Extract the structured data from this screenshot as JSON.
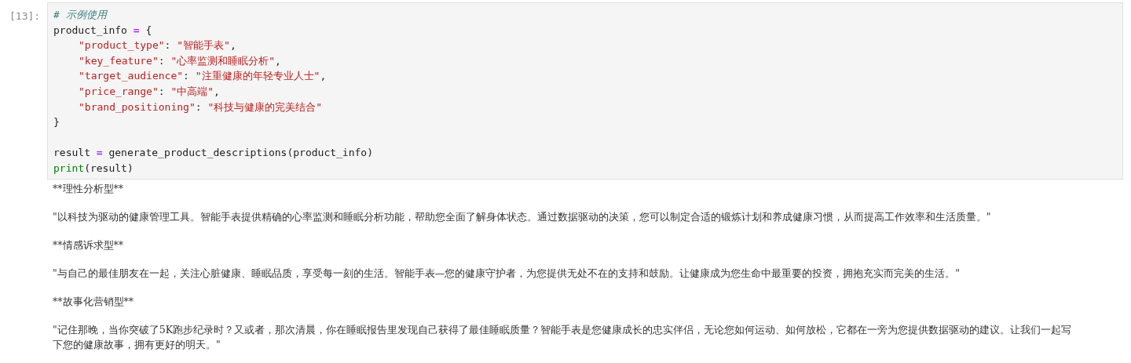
{
  "cell": {
    "prompt": "[13]:",
    "code_lines": [
      {
        "kind": "top",
        "tokens": [
          {
            "kind": "comment",
            "text": "# 示例使用"
          }
        ]
      },
      {
        "kind": "top",
        "tokens": [
          {
            "kind": "plain",
            "text": "product_info "
          },
          {
            "kind": "op",
            "text": "="
          },
          {
            "kind": "plain",
            "text": " {"
          }
        ]
      },
      {
        "kind": "entry",
        "tokens": [
          {
            "kind": "string",
            "text": "\"product_type\""
          },
          {
            "kind": "plain",
            "text": ": "
          },
          {
            "kind": "string",
            "text": "\"智能手表\""
          },
          {
            "kind": "plain",
            "text": ","
          }
        ]
      },
      {
        "kind": "entry",
        "tokens": [
          {
            "kind": "string",
            "text": "\"key_feature\""
          },
          {
            "kind": "plain",
            "text": ": "
          },
          {
            "kind": "string",
            "text": "\"心率监测和睡眠分析\""
          },
          {
            "kind": "plain",
            "text": ","
          }
        ]
      },
      {
        "kind": "entry",
        "tokens": [
          {
            "kind": "string",
            "text": "\"target_audience\""
          },
          {
            "kind": "plain",
            "text": ": "
          },
          {
            "kind": "string",
            "text": "\"注重健康的年轻专业人士\""
          },
          {
            "kind": "plain",
            "text": ","
          }
        ]
      },
      {
        "kind": "entry",
        "tokens": [
          {
            "kind": "string",
            "text": "\"price_range\""
          },
          {
            "kind": "plain",
            "text": ": "
          },
          {
            "kind": "string",
            "text": "\"中高端\""
          },
          {
            "kind": "plain",
            "text": ","
          }
        ]
      },
      {
        "kind": "entry",
        "tokens": [
          {
            "kind": "string",
            "text": "\"brand_positioning\""
          },
          {
            "kind": "plain",
            "text": ": "
          },
          {
            "kind": "string",
            "text": "\"科技与健康的完美结合\""
          }
        ]
      },
      {
        "kind": "top",
        "tokens": [
          {
            "kind": "plain",
            "text": "}"
          }
        ]
      },
      {
        "kind": "blank"
      },
      {
        "kind": "top",
        "tokens": [
          {
            "kind": "plain",
            "text": "result "
          },
          {
            "kind": "op",
            "text": "="
          },
          {
            "kind": "plain",
            "text": " generate_product_descriptions(product_info)"
          }
        ]
      },
      {
        "kind": "top",
        "tokens": [
          {
            "kind": "builtin",
            "text": "print"
          },
          {
            "kind": "plain",
            "text": "(result)"
          }
        ]
      }
    ]
  },
  "output": [
    "**理性分析型**",
    "\"以科技为驱动的健康管理工具。智能手表提供精确的心率监测和睡眠分析功能，帮助您全面了解身体状态。通过数据驱动的决策，您可以制定合适的锻炼计划和养成健康习惯，从而提高工作效率和生活质量。\"",
    "**情感诉求型**",
    "\"与自己的最佳朋友在一起，关注心脏健康、睡眠品质，享受每一刻的生活。智能手表—您的健康守护者，为您提供无处不在的支持和鼓励。让健康成为您生命中最重要的投资，拥抱充实而完美的生活。\"",
    "**故事化营销型**",
    "\"记住那晚，当你突破了5K跑步纪录时？又或者，那次清晨，你在睡眠报告里发现自己获得了最佳睡眠质量？智能手表是您健康成长的忠实伴侣，无论您如何运动、如何放松，它都在一旁为您提供数据驱动的建议。让我们一起写下您的健康故事，拥有更好的明天。\""
  ]
}
